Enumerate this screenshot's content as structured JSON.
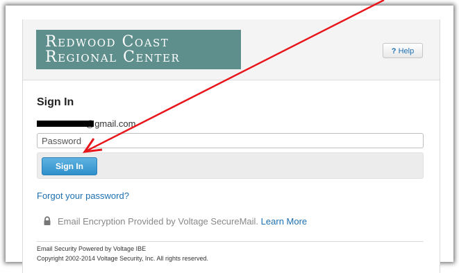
{
  "logo": {
    "line1": "Redwood Coast",
    "line2": "Regional Center"
  },
  "help_button": {
    "icon": "?",
    "label": "Help"
  },
  "signin": {
    "title": "Sign In",
    "email_visible_suffix": "@gmail.com",
    "password_placeholder": "Password",
    "button_label": "Sign In"
  },
  "forgot_password": "Forgot your password?",
  "encryption": {
    "text": "Email Encryption Provided by Voltage SecureMail.",
    "link": "Learn More"
  },
  "footer": {
    "line1": "Email Security Powered by Voltage IBE",
    "line2": "Copyright 2002-2014 Voltage Security, Inc. All rights reserved."
  },
  "colors": {
    "logo_bg": "#5f8f8c",
    "link": "#1c6fb0",
    "button": "#2f8fcb",
    "annotation_arrow": "#e8151b"
  },
  "icons": [
    "lock-icon",
    "question-icon",
    "annotation-arrow"
  ]
}
